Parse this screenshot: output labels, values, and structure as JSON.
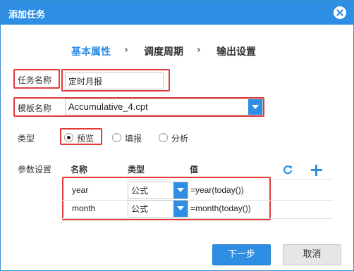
{
  "dialog": {
    "title": "添加任务"
  },
  "steps": [
    {
      "label": "基本属性",
      "active": true
    },
    {
      "label": "调度周期",
      "active": false
    },
    {
      "label": "输出设置",
      "active": false
    }
  ],
  "step_separator": "›",
  "form": {
    "task_name_label": "任务名称",
    "task_name_value": "定时月报",
    "template_label": "模板名称",
    "template_value": "Accumulative_4.cpt",
    "type_label": "类型",
    "type_options": [
      {
        "label": "预览",
        "checked": true
      },
      {
        "label": "填报",
        "checked": false
      },
      {
        "label": "分析",
        "checked": false
      }
    ],
    "params_label": "参数设置"
  },
  "params_table": {
    "headers": [
      "名称",
      "类型",
      "值"
    ],
    "rows": [
      {
        "name": "year",
        "type": "公式",
        "value": "=year(today())"
      },
      {
        "name": "month",
        "type": "公式",
        "value": "=month(today())"
      }
    ],
    "refresh_icon": "refresh-icon",
    "add_icon": "plus-icon"
  },
  "buttons": {
    "next": "下一步",
    "cancel": "取消"
  },
  "colors": {
    "accent": "#2d8ee3",
    "highlight_box": "#e03b3b"
  }
}
